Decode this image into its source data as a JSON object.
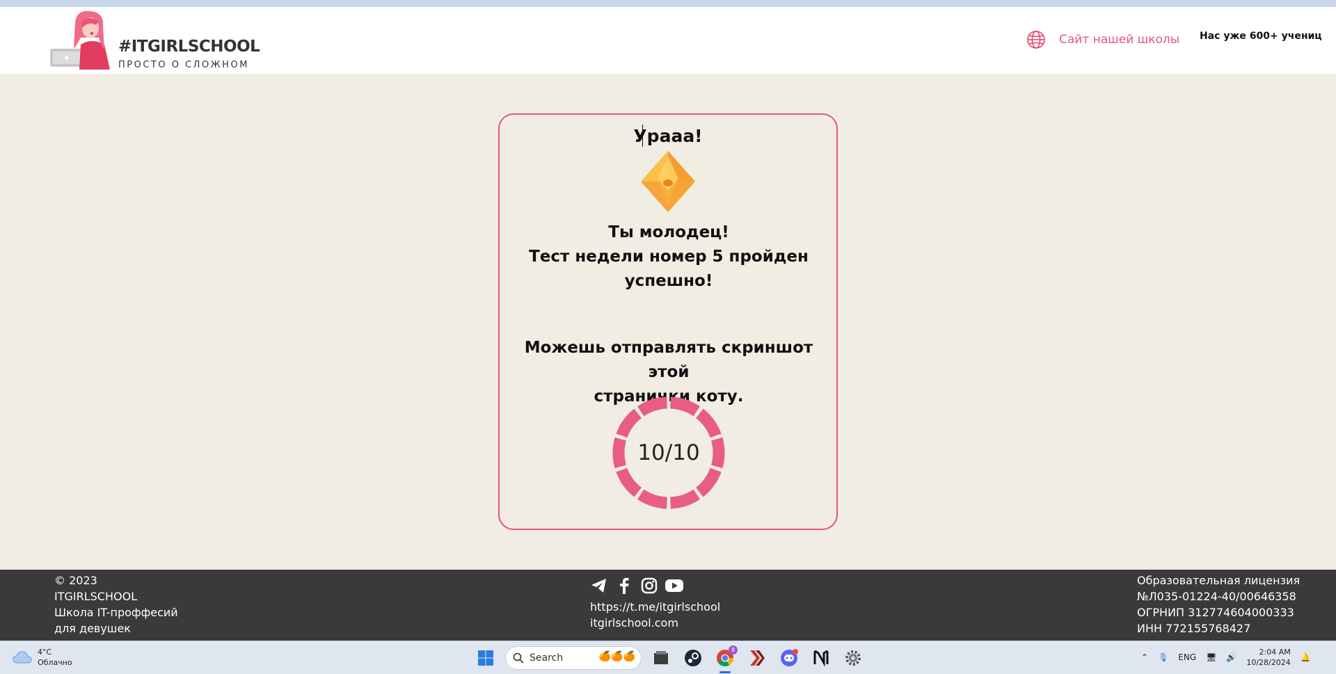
{
  "header": {
    "logo_title": "#ITGIRLSCHOOL",
    "logo_subtitle": "ПРОСТО О СЛОЖНОМ",
    "site_link_label": "Сайт нашей школы",
    "students_text": "Нас уже 600+ учениц"
  },
  "card": {
    "title": "Урааа!",
    "praise_line1": "Ты молодец!",
    "praise_line2": "Тест недели номер 5 пройден",
    "praise_line3": "успешно!",
    "hint_line1": "Можешь отправлять скриншот этой",
    "hint_line2": "странички коту.",
    "score_text": "10/10",
    "score_correct": 10,
    "score_total": 10,
    "accent_color": "#e85d84"
  },
  "footer": {
    "left_lines": [
      "© 2023",
      "ITGIRLSCHOOL",
      "Школа IT-проффесий",
      "для девушек"
    ],
    "links": [
      "https://t.me/itgirlschool",
      "itgirlschool.com"
    ],
    "social_icons": [
      "telegram-icon",
      "facebook-icon",
      "instagram-icon",
      "youtube-icon"
    ],
    "right_lines": [
      "Образовательная лицензия",
      "№Л035-01224-40/00646358",
      "ОГРНИП 312774604000333",
      "ИНН 772155768427"
    ]
  },
  "taskbar": {
    "weather_temp": "4°C",
    "weather_desc": "Облачно",
    "search_placeholder": "Search",
    "language": "ENG",
    "time": "2:04 AM",
    "date": "10/28/2024",
    "chrome_badge": "8"
  }
}
